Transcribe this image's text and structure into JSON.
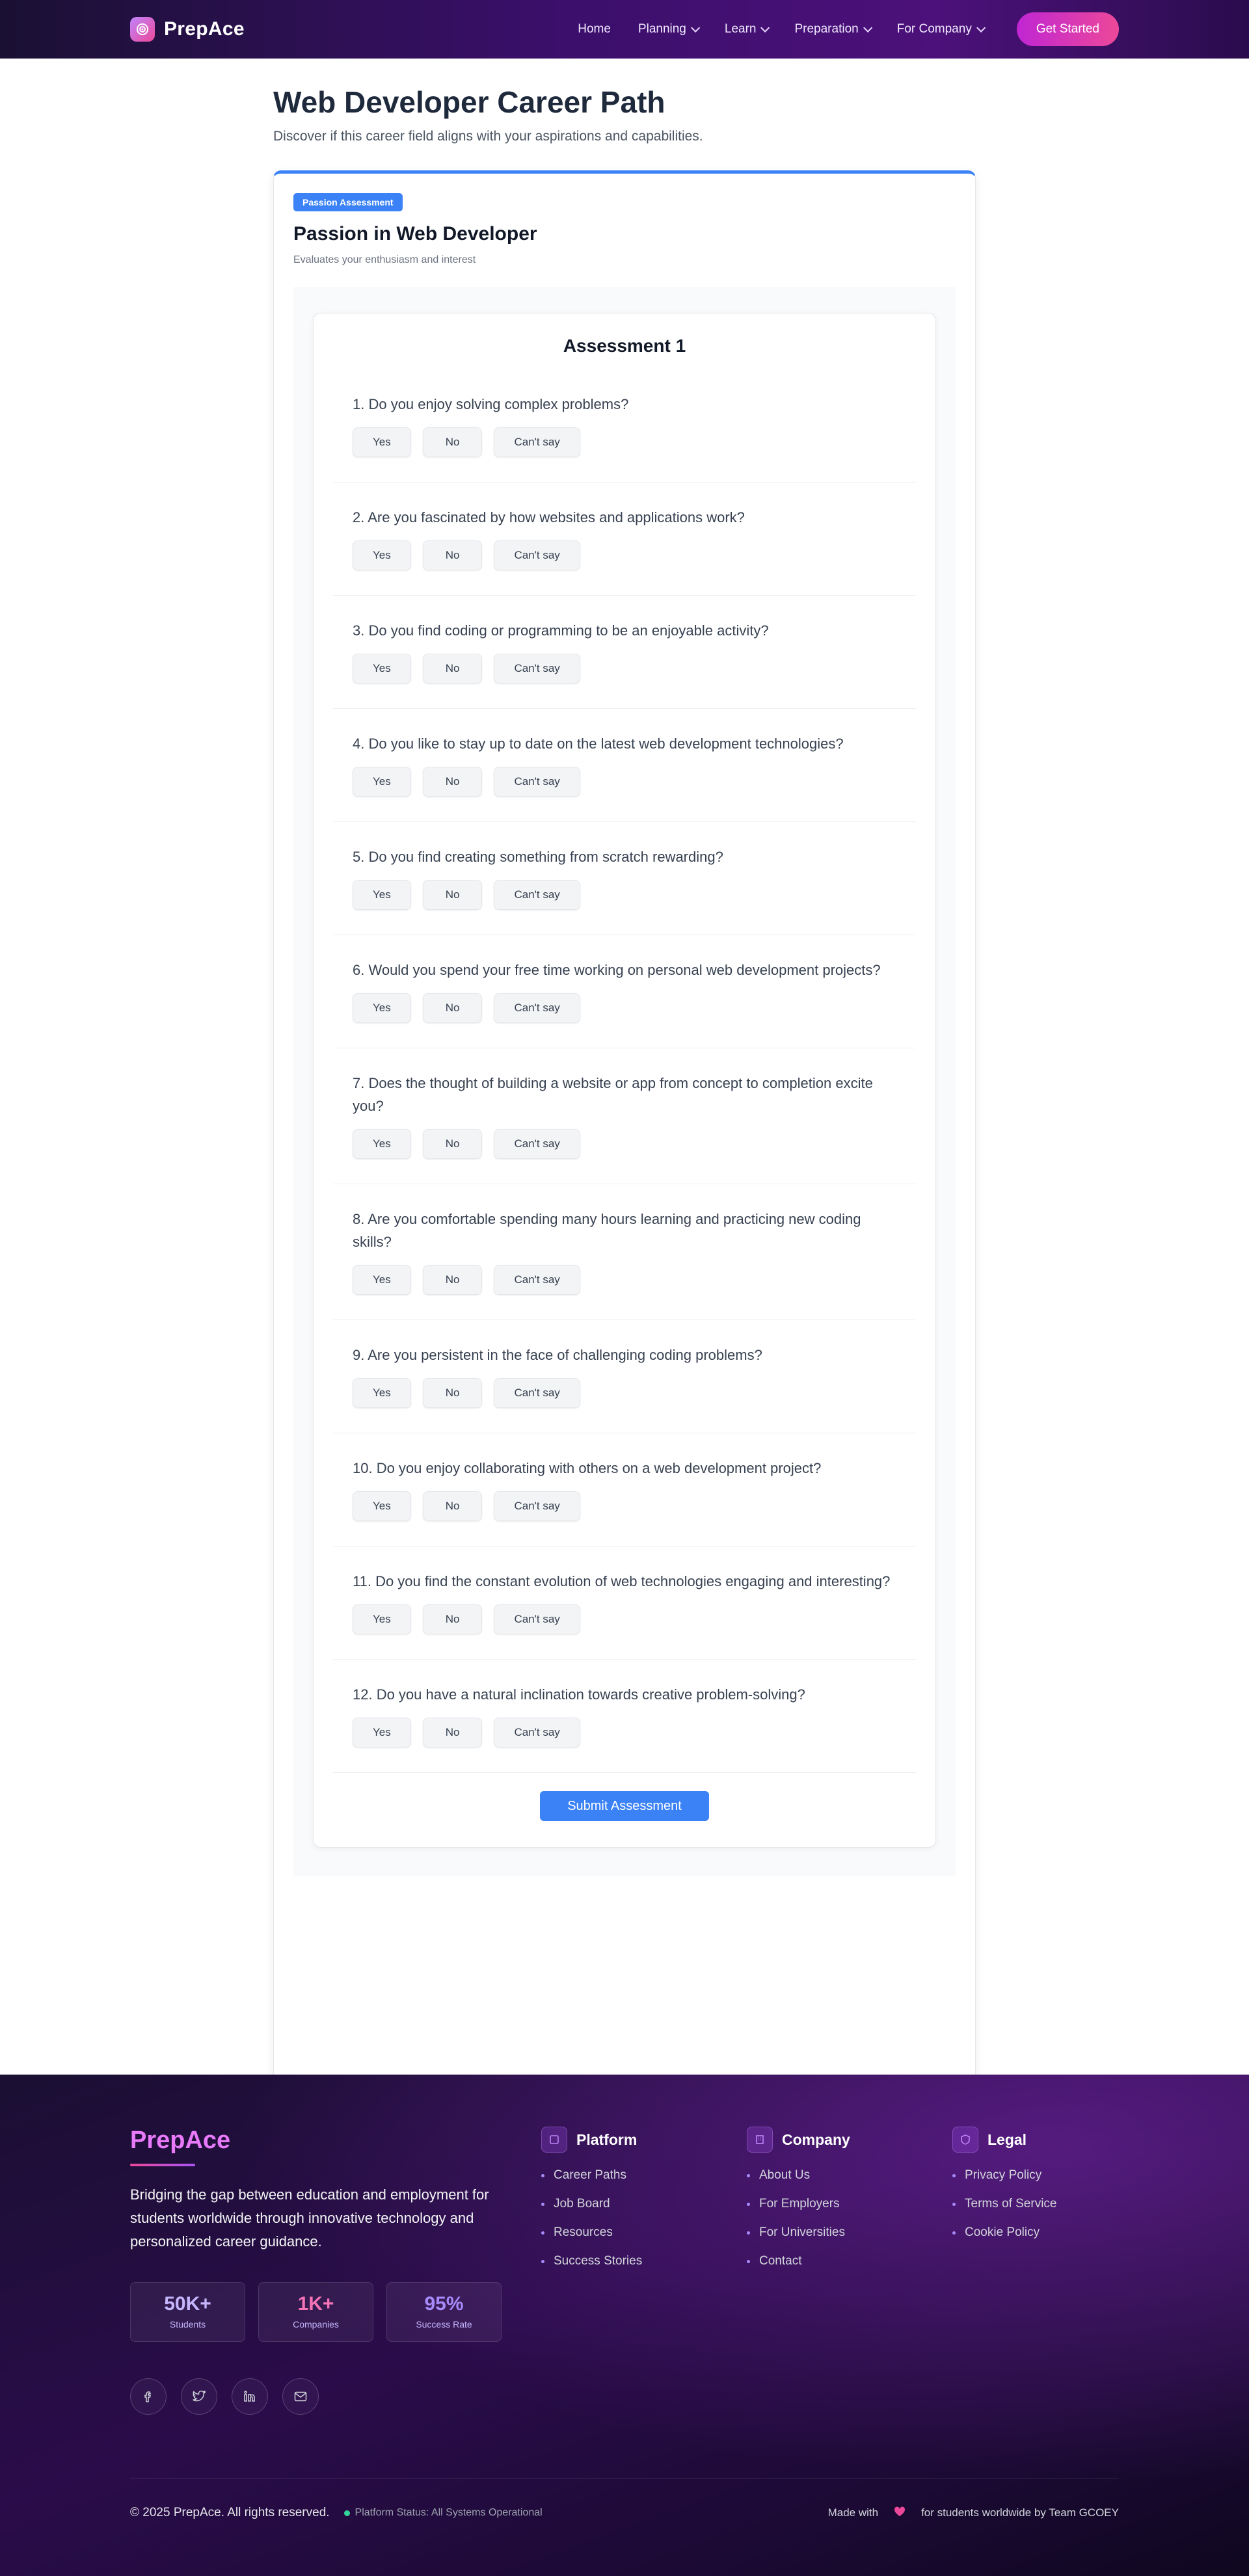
{
  "nav": {
    "brand": "PrepAce",
    "links": [
      {
        "label": "Home",
        "dropdown": false
      },
      {
        "label": "Planning",
        "dropdown": true
      },
      {
        "label": "Learn",
        "dropdown": true
      },
      {
        "label": "Preparation",
        "dropdown": true
      },
      {
        "label": "For Company",
        "dropdown": true
      }
    ],
    "cta": "Get Started"
  },
  "page": {
    "title": "Web Developer Career Path",
    "subtitle": "Discover if this career field aligns with your aspirations and capabilities."
  },
  "section": {
    "badge": "Passion Assessment",
    "title": "Passion in Web Developer",
    "subtitle": "Evaluates your enthusiasm and interest"
  },
  "assessment": {
    "title": "Assessment 1",
    "options": [
      "Yes",
      "No",
      "Can't say"
    ],
    "questions": [
      "1. Do you enjoy solving complex problems?",
      "2. Are you fascinated by how websites and applications work?",
      "3. Do you find coding or programming to be an enjoyable activity?",
      "4. Do you like to stay up to date on the latest web development technologies?",
      "5. Do you find creating something from scratch rewarding?",
      "6. Would you spend your free time working on personal web development projects?",
      "7. Does the thought of building a website or app from concept to completion excite you?",
      "8. Are you comfortable spending many hours learning and practicing new coding skills?",
      "9. Are you persistent in the face of challenging coding problems?",
      "10. Do you enjoy collaborating with others on a web development project?",
      "11. Do you find the constant evolution of web technologies engaging and interesting?",
      "12. Do you have a natural inclination towards creative problem-solving?"
    ],
    "submit": "Submit Assessment"
  },
  "footer": {
    "brand": "PrepAce",
    "description": "Bridging the gap between education and employment for students worldwide through innovative technology and personalized career guidance.",
    "stats": [
      {
        "value": "50K+",
        "label": "Students",
        "color": "#c4b5fd"
      },
      {
        "value": "1K+",
        "label": "Companies",
        "color": "#f472b6"
      },
      {
        "value": "95%",
        "label": "Success Rate",
        "color": "#a78bfa"
      }
    ],
    "socials": [
      "facebook-icon",
      "twitter-icon",
      "linkedin-icon",
      "mail-icon"
    ],
    "columns": [
      {
        "title": "Platform",
        "icon": "grid-icon",
        "items": [
          "Career Paths",
          "Job Board",
          "Resources",
          "Success Stories"
        ]
      },
      {
        "title": "Company",
        "icon": "building-icon",
        "items": [
          "About Us",
          "For Employers",
          "For Universities",
          "Contact"
        ]
      },
      {
        "title": "Legal",
        "icon": "shield-icon",
        "items": [
          "Privacy Policy",
          "Terms of Service",
          "Cookie Policy"
        ]
      }
    ],
    "copyright": "© 2025 PrepAce. All rights reserved.",
    "status": "Platform Status: All Systems Operational",
    "made_with": "Made with",
    "made_by": "for students worldwide by Team GCOEY"
  },
  "colors": {
    "accent": "#3b82f6",
    "brand_pink": "#ec4899",
    "brand_purple": "#a855f7"
  }
}
